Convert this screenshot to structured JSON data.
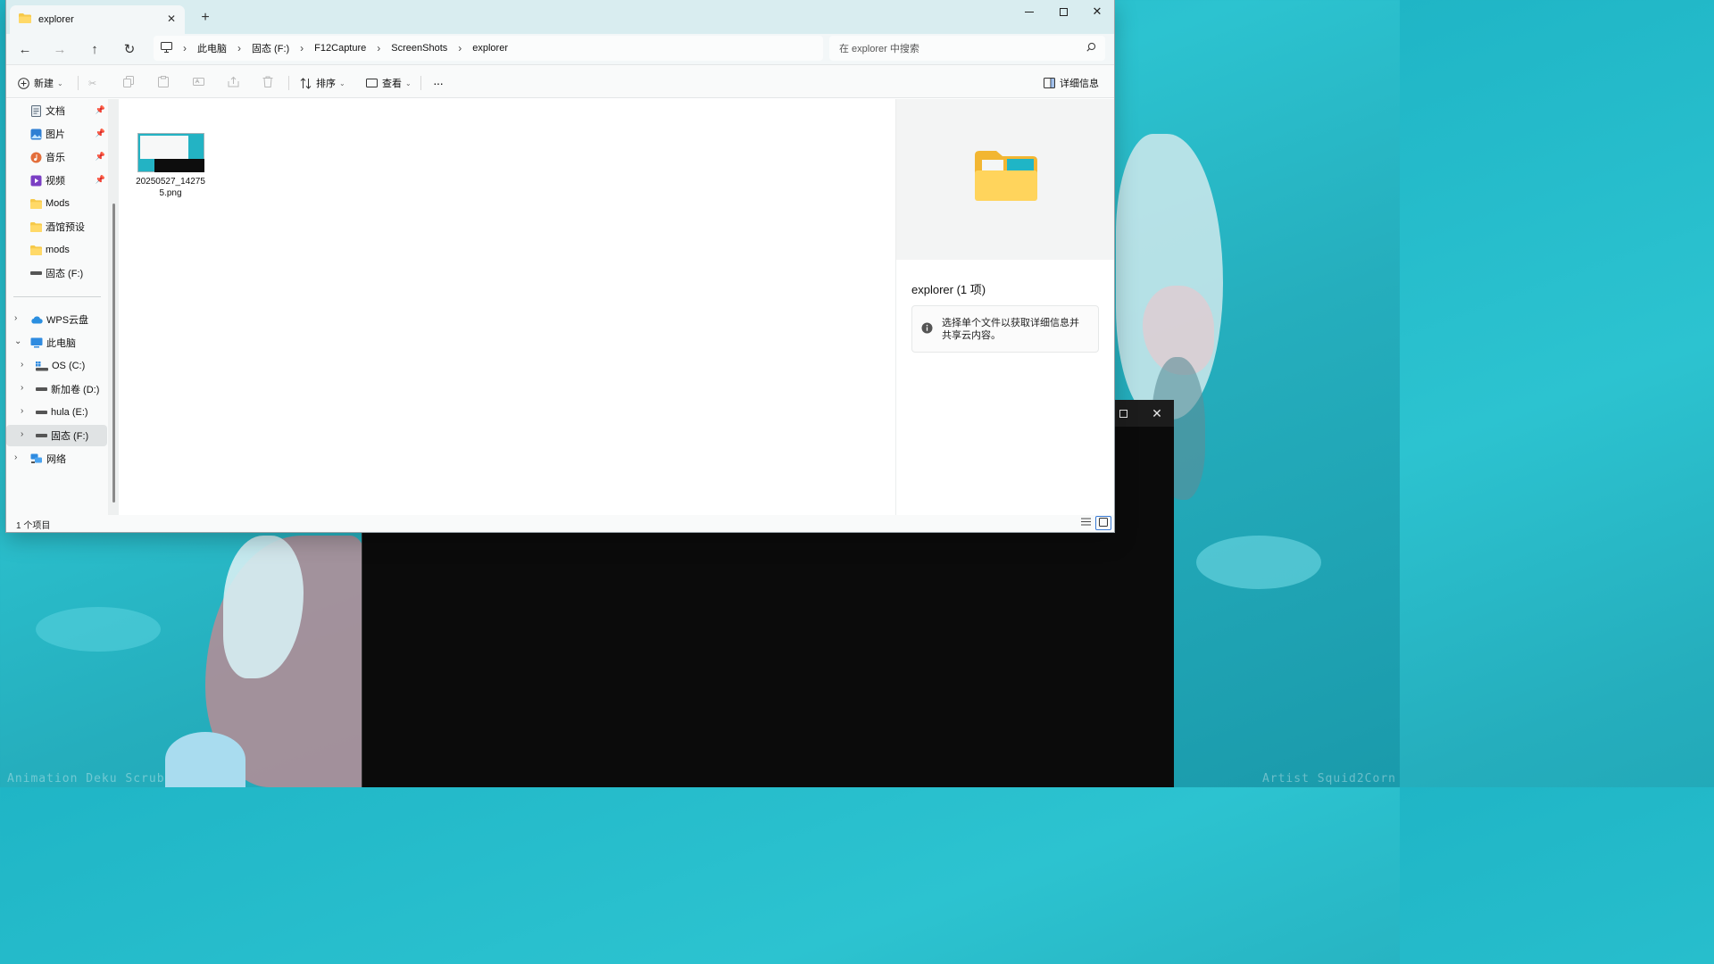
{
  "wallpaper": {
    "watermark_left": "Animation  Deku Scrub",
    "watermark_right": "Artist  Squid2Corn"
  },
  "tab": {
    "title": "explorer"
  },
  "window_controls": {
    "new_tab": "+"
  },
  "breadcrumb": [
    "此电脑",
    "固态 (F:)",
    "F12Capture",
    "ScreenShots",
    "explorer"
  ],
  "search": {
    "placeholder": "在 explorer 中搜索"
  },
  "toolbar": {
    "new_label": "新建",
    "sort_label": "排序",
    "view_label": "查看",
    "more_label": "···",
    "details_label": "详细信息"
  },
  "sidebar": {
    "pinned": [
      {
        "label": "文档",
        "icon": "documents-icon"
      },
      {
        "label": "图片",
        "icon": "pictures-icon"
      },
      {
        "label": "音乐",
        "icon": "music-icon"
      },
      {
        "label": "视频",
        "icon": "videos-icon"
      },
      {
        "label": "Mods",
        "icon": "folder-icon"
      },
      {
        "label": "酒馆预设",
        "icon": "folder-icon"
      },
      {
        "label": "mods",
        "icon": "folder-icon"
      },
      {
        "label": "固态 (F:)",
        "icon": "drive-icon"
      }
    ],
    "tree": [
      {
        "label": "WPS云盘",
        "icon": "cloud-icon"
      },
      {
        "label": "此电脑",
        "icon": "pc-icon"
      },
      {
        "label": "OS (C:)",
        "icon": "windows-drive-icon"
      },
      {
        "label": "新加卷 (D:)",
        "icon": "drive-icon"
      },
      {
        "label": "hula (E:)",
        "icon": "drive-icon"
      },
      {
        "label": "固态 (F:)",
        "icon": "drive-icon"
      },
      {
        "label": "网络",
        "icon": "network-icon"
      }
    ]
  },
  "files": [
    {
      "name": "20250527_142755.png"
    }
  ],
  "details": {
    "title": "explorer (1 项)",
    "info": "选择单个文件以获取详细信息并共享云内容。"
  },
  "status": {
    "count": "1 个项目"
  },
  "colors": {
    "accent": "#3a7bd5",
    "titlebar": "#d9edf0",
    "folder": "#f6c94a",
    "selected": "#e0e3e4"
  }
}
